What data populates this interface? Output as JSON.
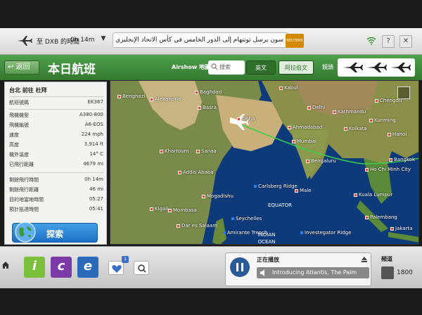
{
  "topbar": {
    "route": "至 DXB 的時間",
    "eta": "0h 14m",
    "news_ticker": "سون يرسل توتنهام إلى الدور الخامس في كأس الاتحاد الإنجليزي",
    "reuters": "REUTERS",
    "help": "?",
    "close": "✕"
  },
  "header": {
    "back_label": "返回",
    "title": "本日航班",
    "airshow_label": "Airshow 地圖",
    "search_placeholder": "搜索",
    "lang_en": "英文",
    "lang_ar": "阿拉伯文",
    "lens_label": "鏡頭"
  },
  "flight_info": {
    "route": "台北 前往 杜拜",
    "rows": [
      {
        "label": "航班號碼",
        "value": "EK367"
      },
      {
        "label": "飛機機型",
        "value": "A380-800"
      },
      {
        "label": "飛機編號",
        "value": "A6-EOS"
      },
      {
        "label": "速度",
        "value": "224 mph"
      },
      {
        "label": "高度",
        "value": "3,914 ft"
      },
      {
        "label": "機外溫度",
        "value": "14° C"
      },
      {
        "label": "已飛行距離",
        "value": "4679 mi"
      },
      {
        "label": "剩餘飛行時間",
        "value": "0h 14m"
      },
      {
        "label": "剩餘飛行距離",
        "value": "46 mi"
      },
      {
        "label": "目的地當地時間",
        "value": "05:27"
      },
      {
        "label": "預計抵達時間",
        "value": "05:41"
      }
    ],
    "search_button": "探索"
  },
  "map": {
    "cities": [
      "Benghazi",
      "Alexandria",
      "Baghdad",
      "Basra",
      "Kabul",
      "Chengdu",
      "Delhi",
      "Kathmandu",
      "Doha",
      "Kunming",
      "Ahmadabad",
      "Kolkata",
      "Hanoi",
      "Khartoum",
      "Sanaa",
      "Mumbai",
      "Addis Ababa",
      "Bengaluru",
      "Bangkok",
      "Ho Chi Minh City",
      "Mogadishu",
      "Male",
      "Kuala Lumpur",
      "Kigali",
      "Mombasa",
      "Dar es Salaam",
      "Palembang",
      "Jakarta"
    ],
    "places": [
      "Carlsberg Ridge",
      "Seychelles",
      "Amirante Trench",
      "Investegator Ridge"
    ],
    "seas": [
      "EQUATOR",
      "INDIAN OCEAN"
    ]
  },
  "bottombar": {
    "heart_badge": "1",
    "apps": [
      "i",
      "c",
      "e"
    ]
  },
  "player": {
    "now_playing_label": "正在播放",
    "track": "Introducing Atlantis, The Palm"
  },
  "channel": {
    "label": "頻道",
    "number": "1800"
  },
  "colors": {
    "header_green": "#3f8c3b",
    "route_line": "#38d048",
    "city_marker": "#e04040",
    "place_marker": "#2a7ff0"
  }
}
